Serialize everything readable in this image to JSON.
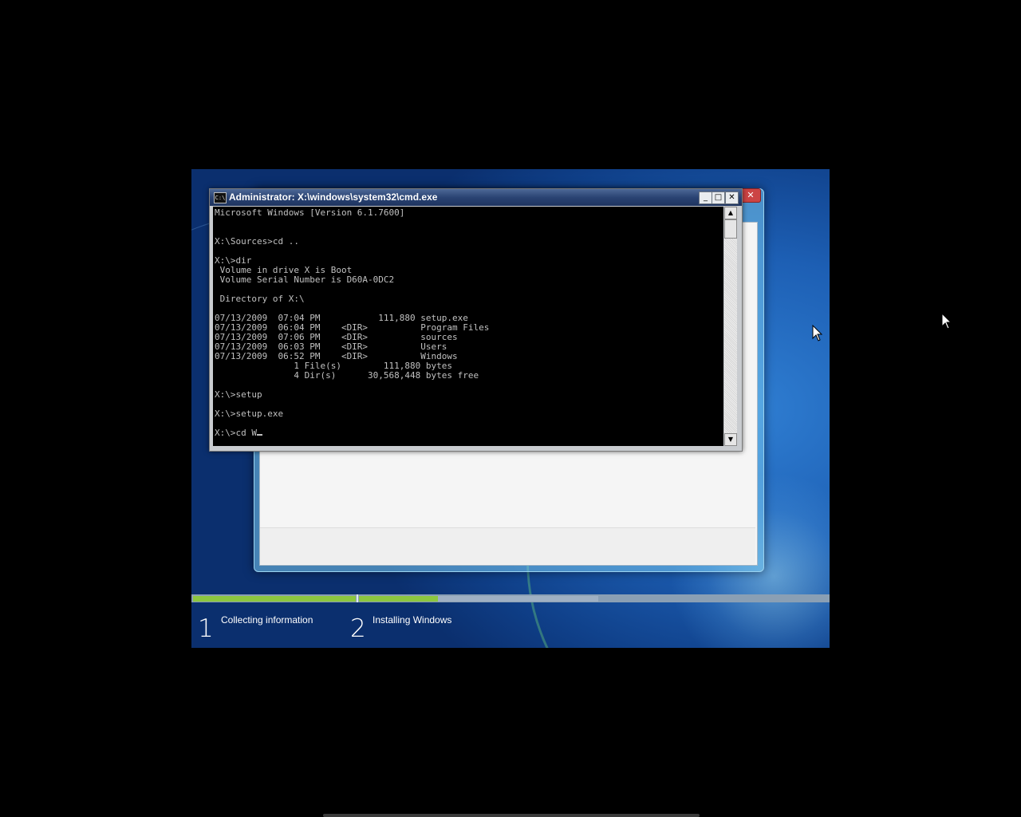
{
  "cmd": {
    "title": "Administrator: X:\\windows\\system32\\cmd.exe",
    "icon_text": "C:\\",
    "console_text": "Microsoft Windows [Version 6.1.7600]\n\n\nX:\\Sources>cd ..\n\nX:\\>dir\n Volume in drive X is Boot\n Volume Serial Number is D60A-0DC2\n\n Directory of X:\\\n\n07/13/2009  07:04 PM           111,880 setup.exe\n07/13/2009  06:04 PM    <DIR>          Program Files\n07/13/2009  07:06 PM    <DIR>          sources\n07/13/2009  06:03 PM    <DIR>          Users\n07/13/2009  06:52 PM    <DIR>          Windows\n               1 File(s)        111,880 bytes\n               4 Dir(s)      30,568,448 bytes free\n\nX:\\>setup\n\nX:\\>setup.exe\n\nX:\\>cd W",
    "buttons": {
      "minimize": "_",
      "maximize": "□",
      "close": "✕"
    },
    "scroll_up": "▲",
    "scroll_down": "▼"
  },
  "setup_dialog": {
    "close_label": "✕"
  },
  "progress": {
    "steps": [
      {
        "number": "1",
        "label": "Collecting information"
      },
      {
        "number": "2",
        "label": "Installing Windows"
      }
    ],
    "step1_fraction": 1.0,
    "step2_fraction": 0.33,
    "colors": {
      "complete": "#8cc63f",
      "pending": "#9fb0c3"
    }
  },
  "icons": {
    "cmd_icon": "command-prompt-icon",
    "pointer": "mouse-pointer-icon"
  }
}
